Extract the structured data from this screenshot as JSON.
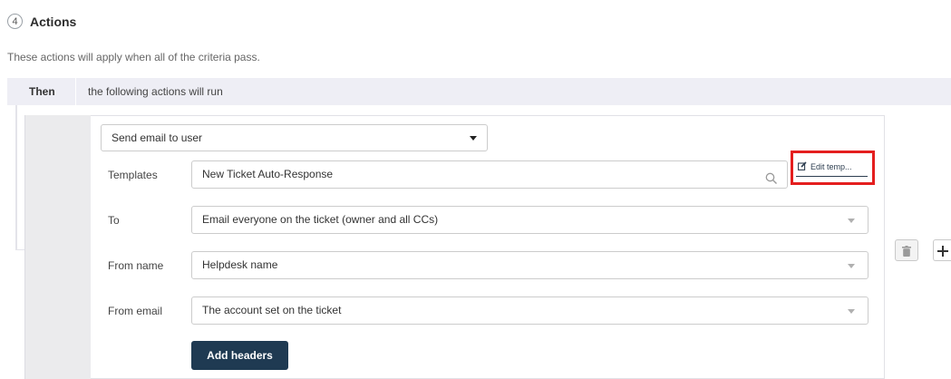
{
  "section": {
    "step_number": "4",
    "title": "Actions",
    "subtitle": "These actions will apply when all of the criteria pass."
  },
  "then_bar": {
    "label": "Then",
    "description": "the following actions will run"
  },
  "action": {
    "type_value": "Send email to user",
    "templates": {
      "label": "Templates",
      "value": "New Ticket Auto-Response",
      "edit_link": "Edit temp..."
    },
    "to": {
      "label": "To",
      "value": "Email everyone on the ticket (owner and all CCs)"
    },
    "from_name": {
      "label": "From name",
      "value": "Helpdesk name"
    },
    "from_email": {
      "label": "From email",
      "value": "The account set on the ticket"
    },
    "add_headers_label": "Add headers"
  },
  "side_actions": {
    "delete_icon": "trash-icon",
    "add_icon": "plus-icon"
  },
  "colors": {
    "primary_button": "#1f3a52",
    "highlight": "#e41e1e",
    "then_bar": "#eeeef5"
  }
}
